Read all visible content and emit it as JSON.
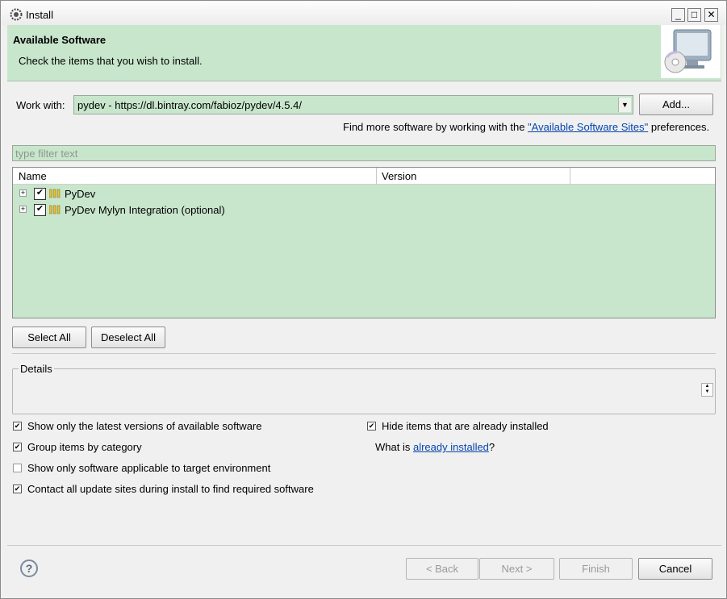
{
  "window": {
    "title": "Install",
    "minimize": "_",
    "maximize": "□",
    "close": "✕"
  },
  "banner": {
    "title": "Available Software",
    "description": "Check the items that you wish to install."
  },
  "work_with": {
    "label": "Work with:",
    "value": "pydev - https://dl.bintray.com/fabioz/pydev/4.5.4/",
    "add_label": "Add...",
    "find_more_prefix": "Find more software by working with the",
    "find_more_link": "\"Available Software Sites\"",
    "find_more_suffix": "preferences."
  },
  "filter": {
    "placeholder": "type filter text"
  },
  "table": {
    "columns": [
      "Name",
      "Version"
    ],
    "rows": [
      {
        "label": "PyDev",
        "checked": true
      },
      {
        "label": "PyDev Mylyn Integration (optional)",
        "checked": true
      }
    ]
  },
  "selection": {
    "select_all": "Select All",
    "deselect_all": "Deselect All"
  },
  "details": {
    "label": "Details"
  },
  "options": {
    "latest_versions": "Show only the latest versions of available software",
    "group_by_category": "Group items by category",
    "applicable_only": "Show only software applicable to target environment",
    "contact_sites": "Contact all update sites during install to find required software",
    "hide_installed": "Hide items that are already installed",
    "what_is_prefix": "What is",
    "what_is_link": "already installed",
    "what_is_suffix": "?"
  },
  "option_states": {
    "latest_versions": true,
    "group_by_category": true,
    "applicable_only": false,
    "contact_sites": true,
    "hide_installed": true
  },
  "footer": {
    "help": "?",
    "back": "< Back",
    "next": "Next >",
    "finish": "Finish",
    "cancel": "Cancel"
  },
  "colors": {
    "highlight_green": "#c8e6cc",
    "link": "#0645ad"
  }
}
